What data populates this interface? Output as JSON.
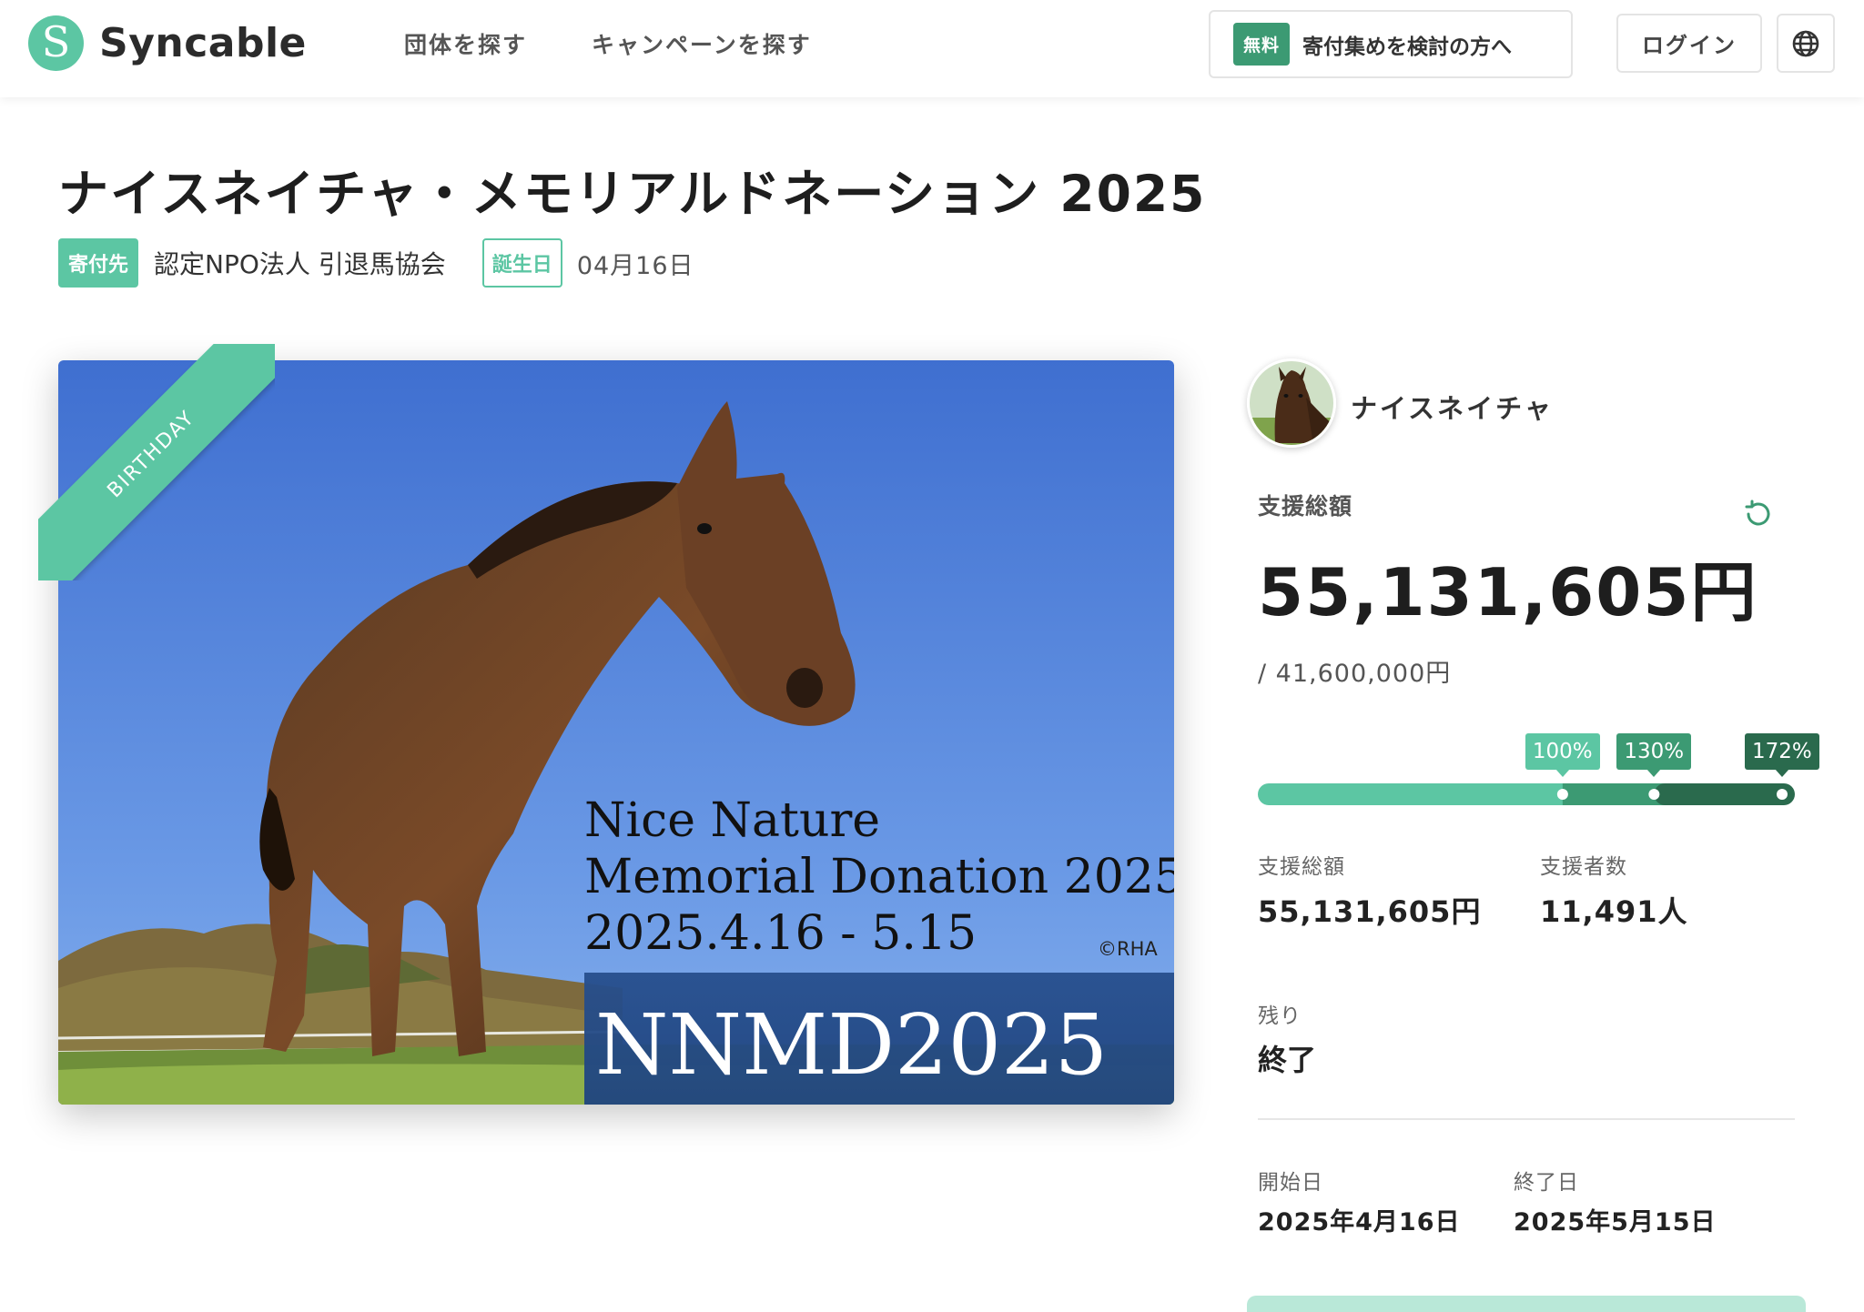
{
  "header": {
    "logo_text": "Syncable",
    "logo_mark": "S",
    "nav": [
      {
        "label": "団体を探す"
      },
      {
        "label": "キャンペーンを探す"
      }
    ],
    "cta_badge": "無料",
    "cta_label": "寄付集めを検討の方へ",
    "login_label": "ログイン",
    "language_icon": "globe-icon"
  },
  "campaign": {
    "title": "ナイスネイチャ・メモリアルドネーション 2025",
    "recipient_tag": "寄付先",
    "recipient": "認定NPO法人 引退馬協会",
    "birthday_tag": "誕生日",
    "birthday": "04月16日"
  },
  "hero": {
    "ribbon": "BIRTHDAY",
    "line1": "Nice Nature",
    "line2": "Memorial Donation 2025",
    "line3": "2025.4.16 - 5.15",
    "credit": "©RHA",
    "banner": "NNMD2025"
  },
  "sidebar": {
    "owner_name": "ナイスネイチャ",
    "total_label": "支援総額",
    "total_amount": "55,131,605円",
    "goal": "/ 41,600,000円",
    "progress_percent": 172,
    "milestones": [
      {
        "label": "100%",
        "value": 100,
        "color": "#5cc6a3"
      },
      {
        "label": "130%",
        "value": 130,
        "color": "#3c9a73"
      },
      {
        "label": "172%",
        "value": 172,
        "color": "#2a6a4d"
      }
    ],
    "stats": {
      "amount_label": "支援総額",
      "amount_value": "55,131,605円",
      "supporters_label": "支援者数",
      "supporters_value": "11,491人"
    },
    "remaining_label": "残り",
    "remaining_value": "終了",
    "start_label": "開始日",
    "start_value": "2025年4月16日",
    "end_label": "終了日",
    "end_value": "2025年5月15日"
  },
  "colors": {
    "accent": "#5cc6a3",
    "accent_dark": "#3c9a73",
    "accent_darker": "#2a6a4d"
  }
}
